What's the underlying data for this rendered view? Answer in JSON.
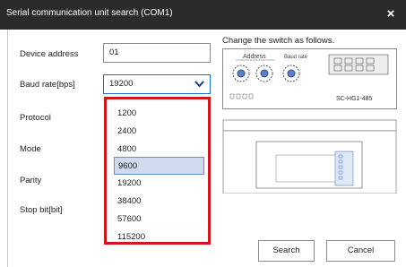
{
  "window": {
    "title": "Serial communication unit search (COM1)",
    "close_icon": "×"
  },
  "form": {
    "device_address_label": "Device address",
    "device_address_value": "01",
    "baud_rate_label": "Baud rate[bps]",
    "baud_rate_value": "19200",
    "protocol_label": "Protocol",
    "mode_label": "Mode",
    "parity_label": "Parity",
    "stop_bit_label": "Stop bit[bit]"
  },
  "dropdown": {
    "options": [
      "1200",
      "2400",
      "4800",
      "9600",
      "19200",
      "38400",
      "57600",
      "115200"
    ],
    "selected": "9600"
  },
  "illustration": {
    "hint": "Change the switch as follows.",
    "address_label": "Address",
    "baud_label": "Baud rate",
    "model_label": "SC-HG1-485"
  },
  "buttons": {
    "search_label": "Search",
    "cancel_label": "Cancel"
  },
  "colors": {
    "title_bg": "#2b2b2b",
    "highlight_border": "#d0161d",
    "selected_bg": "#cfd9ef",
    "accent": "#1a6fcf"
  }
}
